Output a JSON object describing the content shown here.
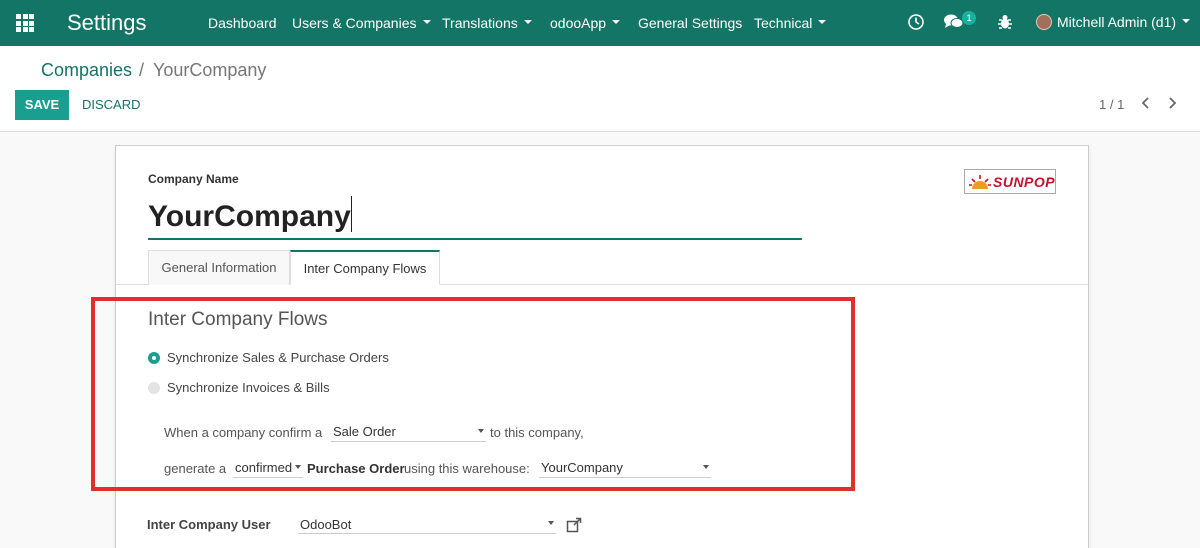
{
  "navbar": {
    "app_title": "Settings",
    "menus": [
      {
        "label": "Dashboard",
        "has_dropdown": false
      },
      {
        "label": "Users & Companies",
        "has_dropdown": true
      },
      {
        "label": "Translations",
        "has_dropdown": true
      },
      {
        "label": "odooApp",
        "has_dropdown": true
      },
      {
        "label": "General Settings",
        "has_dropdown": false
      },
      {
        "label": "Technical",
        "has_dropdown": true
      }
    ],
    "icons": [
      "clock-icon",
      "chat-icon",
      "bug-icon"
    ],
    "message_count": "1",
    "user_label": "Mitchell Admin (d1)"
  },
  "breadcrumb": {
    "parent": "Companies",
    "separator": "/",
    "current": "YourCompany"
  },
  "actions": {
    "save": "SAVE",
    "discard": "DISCARD"
  },
  "pager": {
    "value": "1 / 1"
  },
  "form": {
    "company_name_label": "Company Name",
    "company_name": "YourCompany",
    "logo_text": "SUNPOP",
    "tabs": [
      {
        "label": "General Information",
        "active": false
      },
      {
        "label": "Inter Company Flows",
        "active": true
      }
    ],
    "section_title": "Inter Company Flows",
    "options": [
      {
        "label": "Synchronize Sales & Purchase Orders",
        "selected": true
      },
      {
        "label": "Synchronize Invoices & Bills",
        "selected": false
      }
    ],
    "sentence1": {
      "prefix": "When a company confirm a",
      "select_value": "Sale Order",
      "suffix": "to this company,"
    },
    "sentence2": {
      "prefix": "generate a",
      "state_value": "confirmed",
      "document": "Purchase Order",
      "middle": "using this warehouse:",
      "warehouse_value": "YourCompany"
    },
    "inter_company_user_label": "Inter Company User",
    "inter_company_user_value": "OdooBot"
  },
  "colors": {
    "navbar": "#137565",
    "accent": "#1a9e8f",
    "highlight": "#e12f2f"
  }
}
